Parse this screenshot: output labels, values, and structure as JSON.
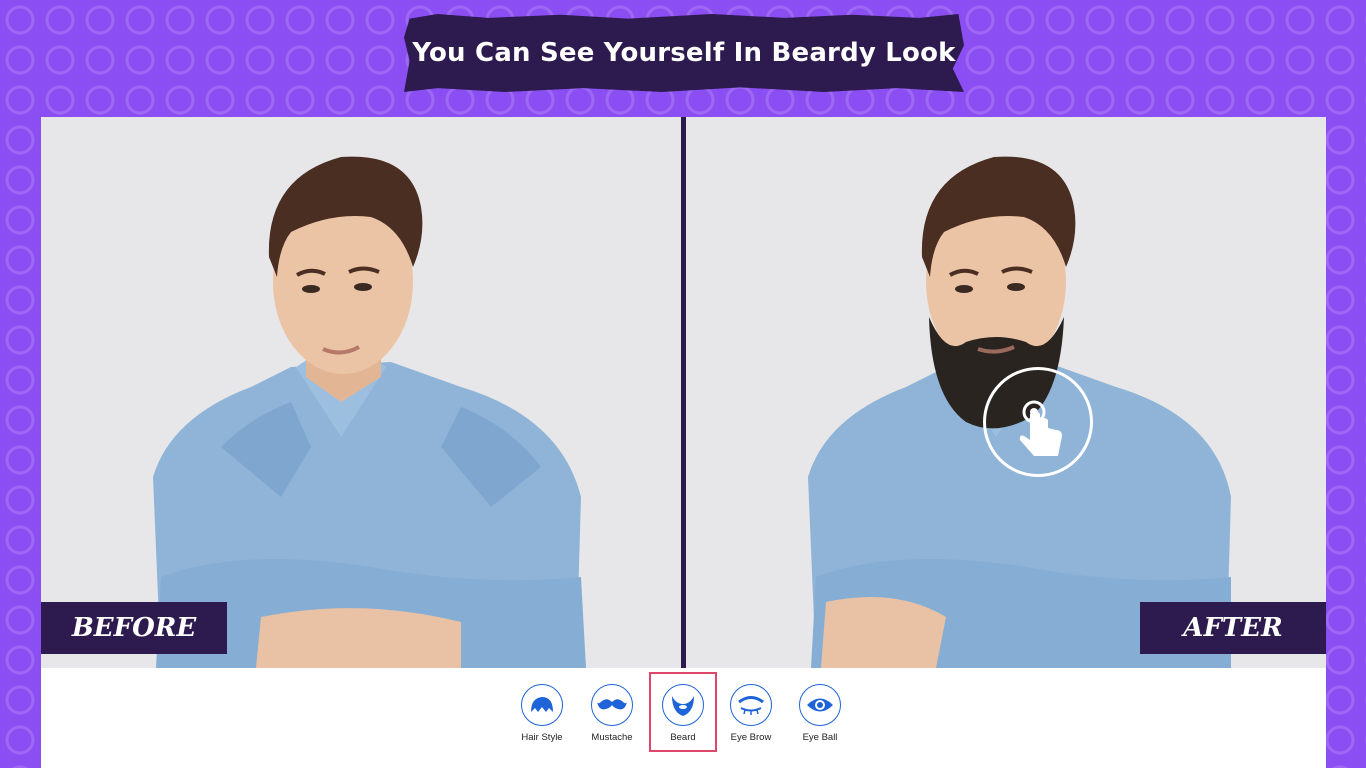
{
  "banner": {
    "title": "You Can See Yourself In Beardy Look"
  },
  "labels": {
    "before": "BEFORE",
    "after": "AFTER"
  },
  "toolbar": {
    "items": [
      {
        "label": "Hair Style",
        "icon": "hair-style-icon"
      },
      {
        "label": "Mustache",
        "icon": "mustache-icon"
      },
      {
        "label": "Beard",
        "icon": "beard-icon",
        "selected": true
      },
      {
        "label": "Eye Brow",
        "icon": "eyebrow-icon"
      },
      {
        "label": "Eye Ball",
        "icon": "eyeball-icon"
      }
    ]
  },
  "colors": {
    "background": "#8b4ef2",
    "banner": "#2d1a4e",
    "icon_blue": "#1e63d8",
    "selected_border": "#e0466c"
  }
}
